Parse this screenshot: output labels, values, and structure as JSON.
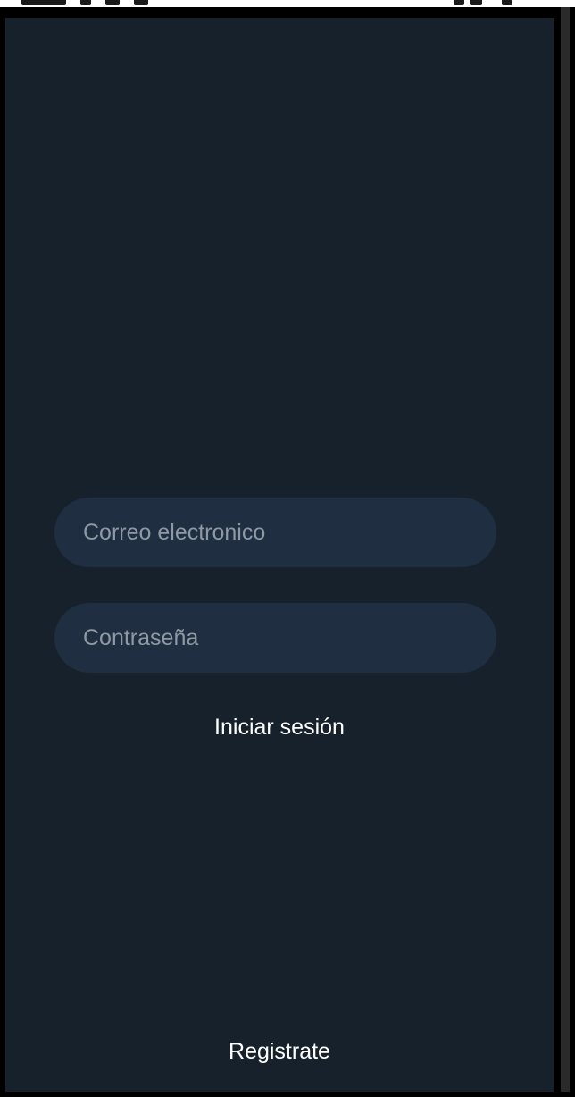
{
  "login_form": {
    "email_placeholder": "Correo electronico",
    "password_placeholder": "Contraseña",
    "login_label": "Iniciar sesión",
    "register_label": "Registrate"
  },
  "colors": {
    "background": "#17212b",
    "field_background": "#1f2e40",
    "placeholder": "#8e99a4",
    "text": "#ffffff"
  }
}
